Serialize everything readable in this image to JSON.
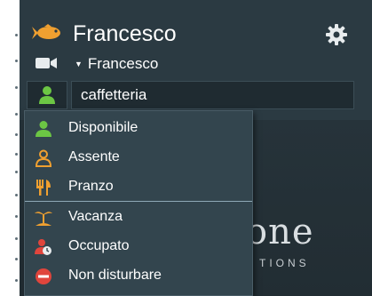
{
  "header": {
    "user_name": "Francesco",
    "account_selector_label": "Francesco",
    "status_message_value": "caffetteria"
  },
  "status_menu": {
    "items": [
      {
        "label": "Disponibile",
        "icon": "user-available-icon",
        "color": "#6cc644"
      },
      {
        "label": "Assente",
        "icon": "user-away-icon",
        "color": "#f0a030"
      },
      {
        "label": "Pranzo",
        "icon": "lunch-icon",
        "color": "#f0a030"
      },
      {
        "label": "Vacanza",
        "icon": "vacation-icon",
        "color": "#f0a030"
      },
      {
        "label": "Occupato",
        "icon": "busy-icon",
        "color": "#e0453c"
      },
      {
        "label": "Non disturbare",
        "icon": "do-not-disturb-icon",
        "color": "#e0453c"
      }
    ],
    "selected_index": 2
  },
  "background": {
    "word": "one",
    "subword": "TIONS"
  },
  "colors": {
    "panel": "#2b3a42",
    "menu": "#33454e",
    "accent_green": "#6cc644",
    "accent_orange": "#f0a030",
    "accent_red": "#e0453c"
  }
}
